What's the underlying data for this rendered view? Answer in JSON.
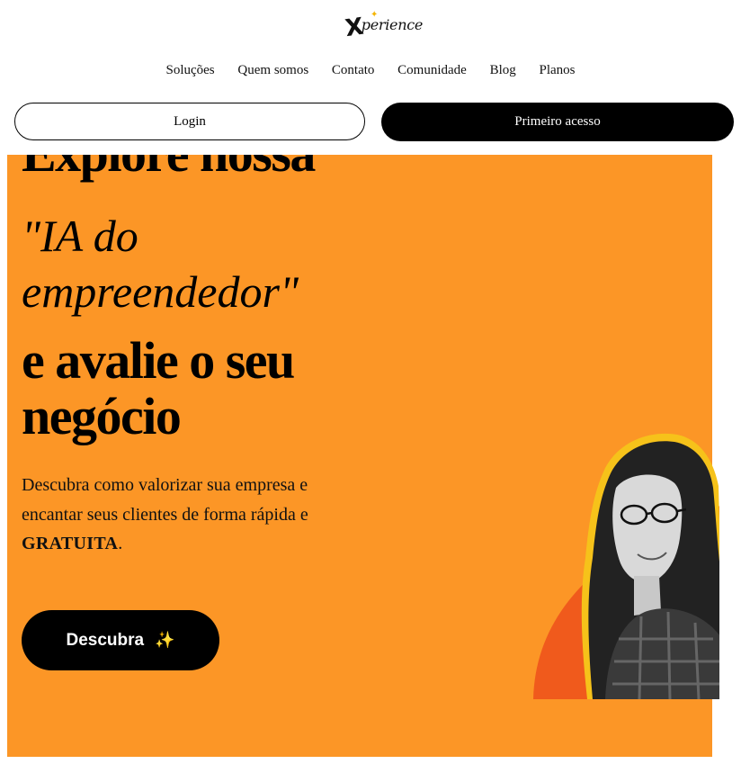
{
  "header": {
    "logo_text": "perience",
    "logo_x": "X",
    "nav": [
      "Soluções",
      "Quem somos",
      "Contato",
      "Comunidade",
      "Blog",
      "Planos"
    ],
    "login_label": "Login",
    "primeiro_label": "Primeiro acesso"
  },
  "hero": {
    "headline_line1": "Explore nossa",
    "headline_italic": "\"IA do empreendedor\"",
    "headline_line3": "e avalie o seu negócio",
    "description_text": "Descubra como valorizar sua empresa e encantar seus clientes de forma rápida e ",
    "description_bold": "GRATUITA",
    "description_end": ".",
    "cta_label": "Descubra",
    "cta_icon": "sparkles-icon"
  },
  "colors": {
    "hero_bg": "#fc9626",
    "accent_dark_orange": "#f05a1c",
    "logo_star": "#f4b400"
  }
}
